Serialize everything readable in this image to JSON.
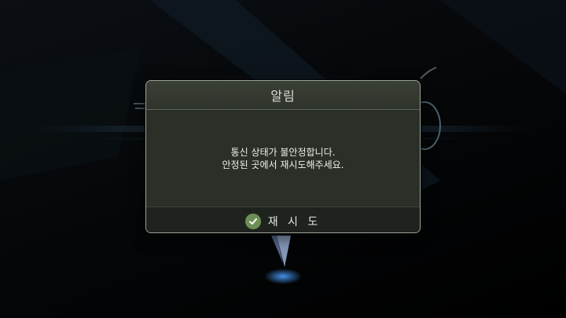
{
  "dialog": {
    "title": "알림",
    "message_line_1": "통신 상태가 불안정합니다.",
    "message_line_2": "안정된 곳에서 재시도해주세요.",
    "retry_label": "재 시 도",
    "retry_icon": "check-circle-icon"
  },
  "colors": {
    "dialog_border": "#9aa39a",
    "dialog_body": "#2a2f27",
    "footer": "#1f231d",
    "accent_check": "#6d8f55"
  }
}
